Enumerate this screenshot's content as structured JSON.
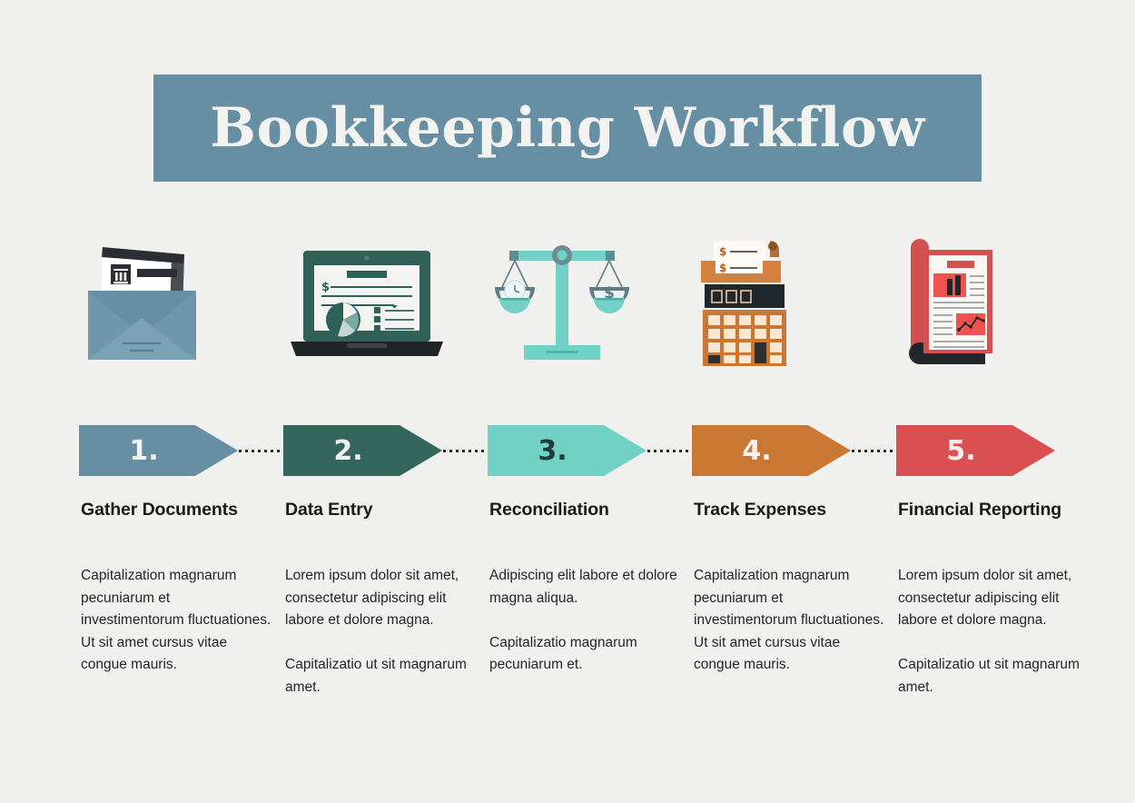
{
  "title": "Bookkeeping Workflow",
  "colors": {
    "background": "#f0f0ee",
    "banner": "#678fa3",
    "banner_text": "#f2f2f0",
    "step1": "#678fa3",
    "step2": "#33665c",
    "step3": "#70d1c4",
    "step4": "#c97733",
    "step5": "#d94f52",
    "heading_text": "#1a1a1a",
    "body_text": "#24262a",
    "connector": "#2d2d2d"
  },
  "steps": [
    {
      "number": "1.",
      "heading": "Gather Documents",
      "icon": "open-envelope-document-icon",
      "color": "#678fa3",
      "number_color": "#f2f2f0",
      "paragraphs": [
        "Capitalization magnarum pecuniarum et investimentorum fluctuationes. Ut sit amet cursus vitae congue mauris."
      ]
    },
    {
      "number": "2.",
      "heading": "Data Entry",
      "icon": "laptop-pie-chart-icon",
      "color": "#33665c",
      "number_color": "#f2f2f0",
      "paragraphs": [
        "Lorem ipsum dolor sit amet, consectetur adipiscing elit labore et dolore magna.",
        "Capitalizatio ut sit magnarum amet."
      ]
    },
    {
      "number": "3.",
      "heading": "Reconciliation",
      "icon": "balance-scale-icon",
      "color": "#70d1c4",
      "number_color": "#1f3b38",
      "paragraphs": [
        "Adipiscing elit labore et dolore magna aliqua.",
        "Capitalizatio magnarum pecuniarum et."
      ]
    },
    {
      "number": "4.",
      "heading": "Track Expenses",
      "icon": "calculator-receipt-icon",
      "color": "#c97733",
      "number_color": "#f7f2ec",
      "paragraphs": [
        "Capitalization magnarum pecuniarum et investimentorum fluctuationes. Ut sit amet cursus vitae congue mauris."
      ]
    },
    {
      "number": "5.",
      "heading": "Financial Reporting",
      "icon": "report-charts-icon",
      "color": "#d94f52",
      "number_color": "#f7ecec",
      "paragraphs": [
        "Lorem ipsum dolor sit amet, consectetur adipiscing elit labore et dolore magna.",
        "Capitalizatio ut sit magnarum amet."
      ]
    }
  ]
}
